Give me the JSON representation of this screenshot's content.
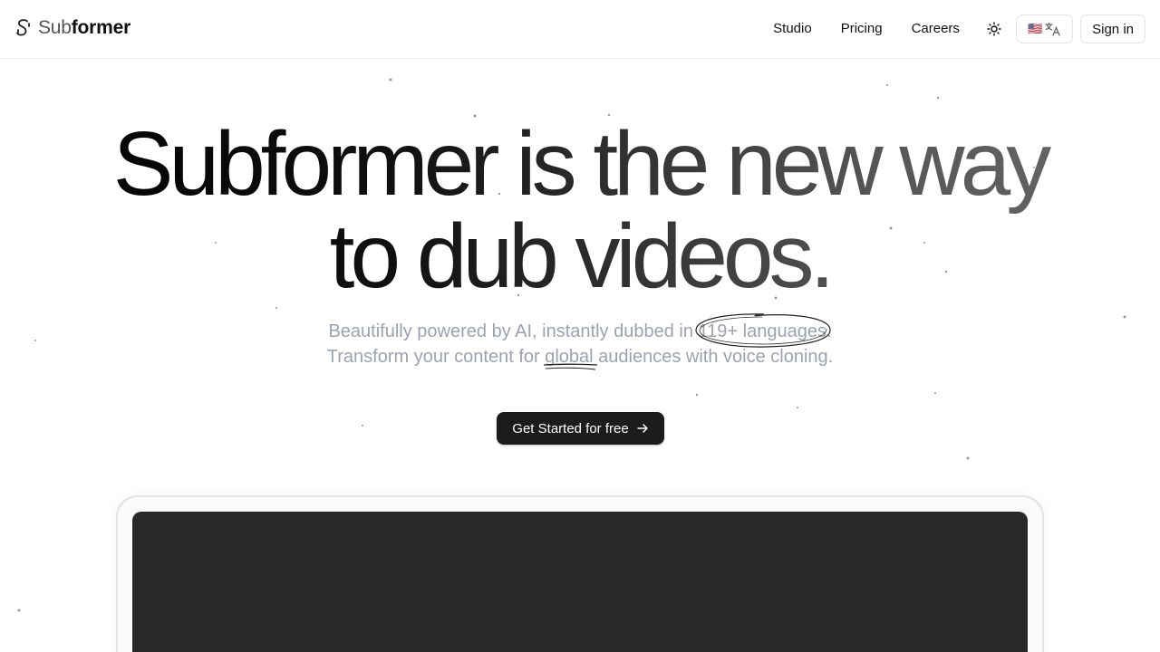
{
  "brand": {
    "name_light": "Sub",
    "name_bold": "former"
  },
  "nav": {
    "links": [
      "Studio",
      "Pricing",
      "Careers"
    ],
    "language_flag": "🇺🇸",
    "sign_in": "Sign in"
  },
  "hero": {
    "line1": "Subformer is the new way",
    "line2": "to dub videos.",
    "sub1_pre": "Beautifully powered by AI, instantly dubbed in ",
    "sub1_hl": "119+ languages",
    "sub1_post": ".",
    "sub2_pre": "Transform your content for ",
    "sub2_hl": "global",
    "sub2_post": " audiences with voice cloning."
  },
  "cta": {
    "label": "Get Started for free"
  },
  "colors": {
    "accent_dark": "#1c1c1c",
    "subtitle": "#9ca3af",
    "video_bg": "#282828"
  }
}
